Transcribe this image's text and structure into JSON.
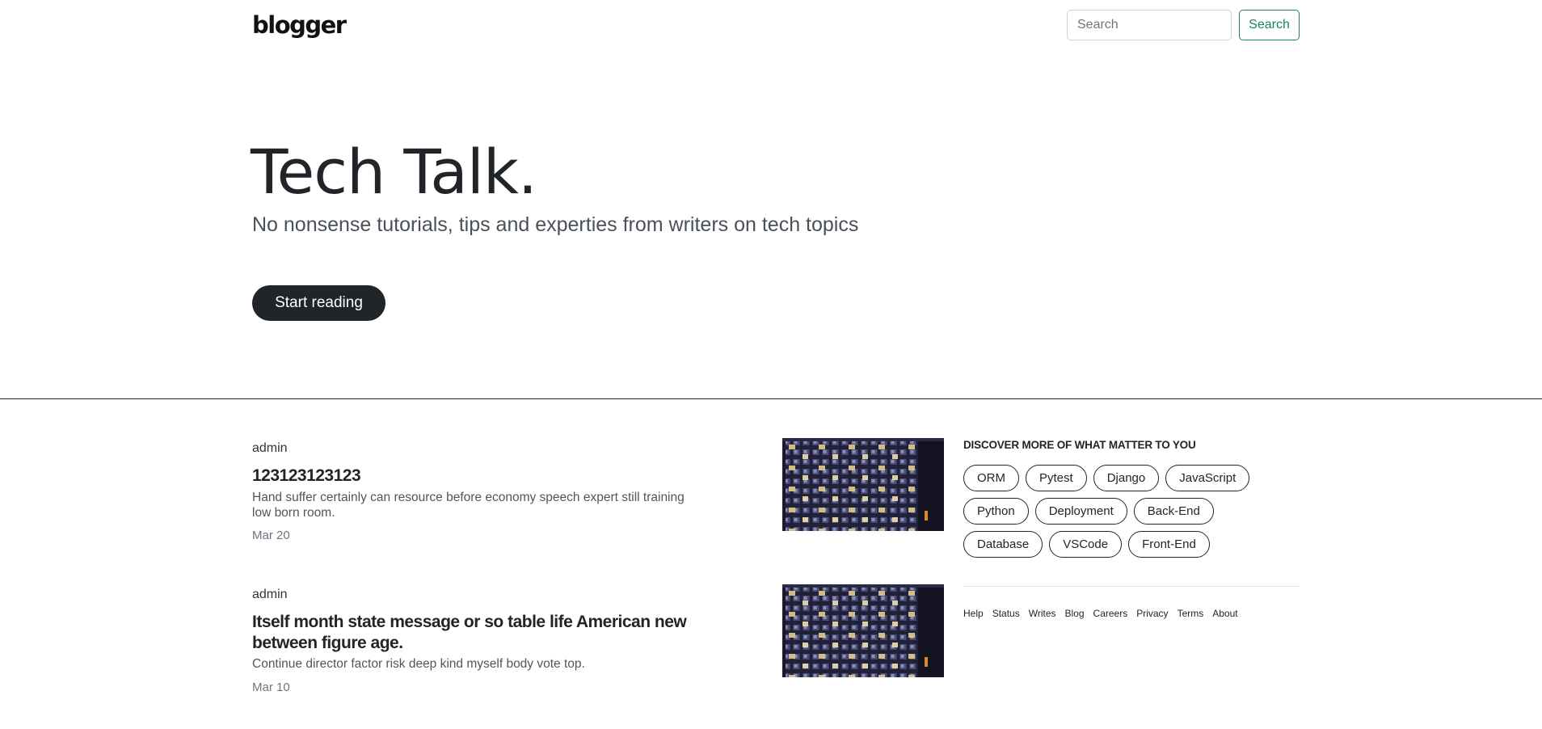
{
  "navbar": {
    "logo": "blogger",
    "search_placeholder": "Search",
    "search_button": "Search"
  },
  "hero": {
    "title": "Tech Talk.",
    "subtitle": "No nonsense tutorials, tips and experties from writers on tech topics",
    "cta": "Start reading"
  },
  "posts": [
    {
      "author": "admin",
      "title": "123123123123",
      "summary": "Hand suffer certainly can resource before economy speech expert still training low born room.",
      "date": "Mar 20"
    },
    {
      "author": "admin",
      "title": "Itself month state message or so table life American new between figure age.",
      "summary": "Continue director factor risk deep kind myself body vote top.",
      "date": "Mar 10"
    }
  ],
  "sidebar": {
    "heading": "DISCOVER MORE OF WHAT MATTER TO YOU",
    "tags": [
      "ORM",
      "Pytest",
      "Django",
      "JavaScript",
      "Python",
      "Deployment",
      "Back-End",
      "Database",
      "VSCode",
      "Front-End"
    ],
    "footer_links": [
      "Help",
      "Status",
      "Writes",
      "Blog",
      "Careers",
      "Privacy",
      "Terms",
      "About"
    ]
  },
  "colors": {
    "accent_green": "#198754",
    "dark": "#212529"
  }
}
